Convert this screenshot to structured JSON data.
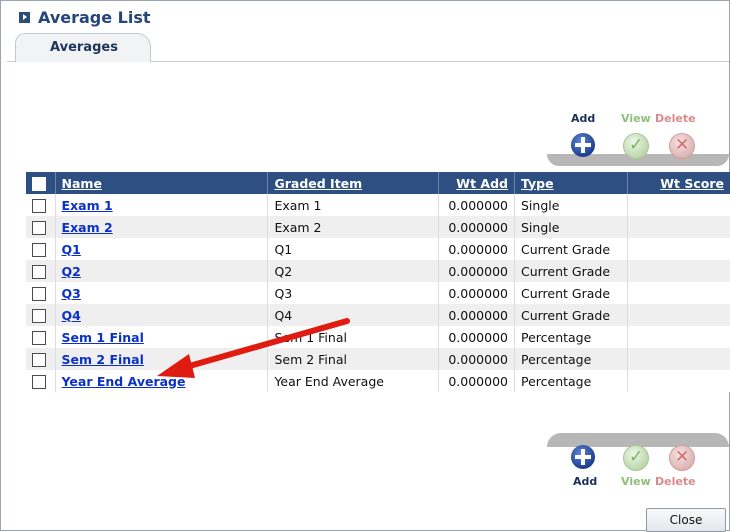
{
  "window": {
    "title": "Average List"
  },
  "tabs": [
    {
      "label": "Averages"
    }
  ],
  "toolbar_top": {
    "add_label": "Add",
    "view_label": "View",
    "delete_label": "Delete"
  },
  "toolbar_bottom": {
    "add_label": "Add",
    "view_label": "View",
    "delete_label": "Delete"
  },
  "table": {
    "columns": [
      "Name",
      "Graded Item",
      "Wt Add",
      "Type",
      "Wt Score"
    ],
    "rows": [
      {
        "name": "Exam 1",
        "graded_item": "Exam 1",
        "wt_add": "0.000000",
        "type": "Single",
        "wt_score": ""
      },
      {
        "name": "Exam 2",
        "graded_item": "Exam 2",
        "wt_add": "0.000000",
        "type": "Single",
        "wt_score": ""
      },
      {
        "name": "Q1",
        "graded_item": "Q1",
        "wt_add": "0.000000",
        "type": "Current Grade",
        "wt_score": ""
      },
      {
        "name": "Q2",
        "graded_item": "Q2",
        "wt_add": "0.000000",
        "type": "Current Grade",
        "wt_score": ""
      },
      {
        "name": "Q3",
        "graded_item": "Q3",
        "wt_add": "0.000000",
        "type": "Current Grade",
        "wt_score": ""
      },
      {
        "name": "Q4",
        "graded_item": "Q4",
        "wt_add": "0.000000",
        "type": "Current Grade",
        "wt_score": ""
      },
      {
        "name": "Sem 1 Final",
        "graded_item": "Sem 1 Final",
        "wt_add": "0.000000",
        "type": "Percentage",
        "wt_score": ""
      },
      {
        "name": "Sem 2 Final",
        "graded_item": "Sem 2 Final",
        "wt_add": "0.000000",
        "type": "Percentage",
        "wt_score": ""
      },
      {
        "name": "Year End Average",
        "graded_item": "Year End Average",
        "wt_add": "0.000000",
        "type": "Percentage",
        "wt_score": ""
      }
    ]
  },
  "footer": {
    "close_label": "Close"
  },
  "colors": {
    "header_bg": "#2e4f82",
    "link": "#0b31c5",
    "arrow": "#e01b12",
    "title": "#24467a"
  },
  "icons": {
    "title": "chevron-right-icon",
    "add": "plus-icon",
    "view": "check-icon",
    "delete": "x-icon",
    "annotation": "red-arrow-icon"
  }
}
